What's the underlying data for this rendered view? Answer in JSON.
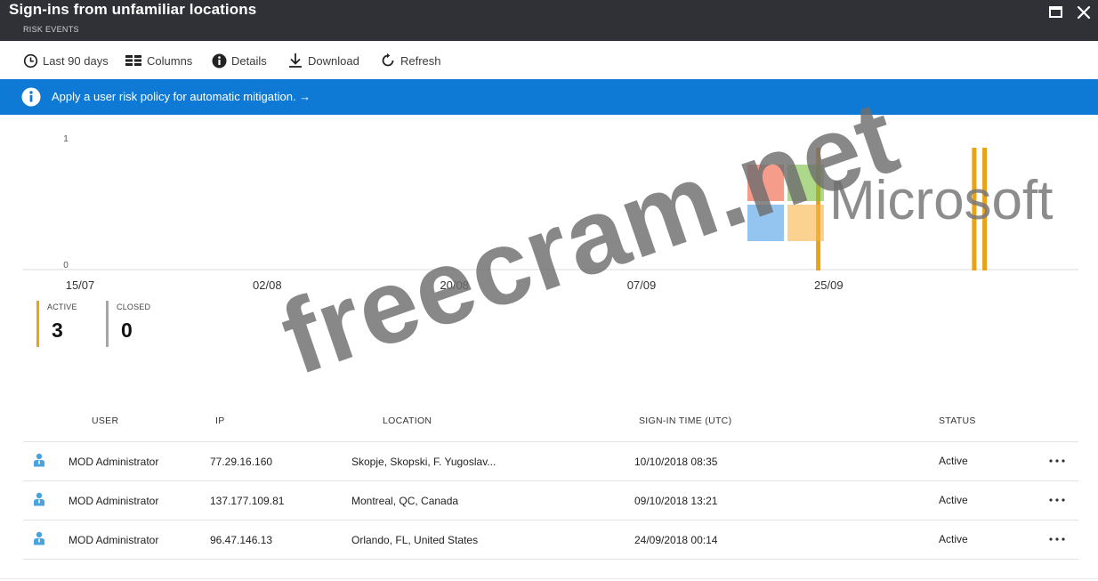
{
  "header": {
    "title": "Sign-ins from unfamiliar locations",
    "subtitle": "RISK EVENTS"
  },
  "toolbar": {
    "items": [
      {
        "label": "Last 90 days",
        "icon": "clock-icon"
      },
      {
        "label": "Columns",
        "icon": "columns-icon"
      },
      {
        "label": "Details",
        "icon": "info-icon"
      },
      {
        "label": "Download",
        "icon": "download-icon"
      },
      {
        "label": "Refresh",
        "icon": "refresh-icon"
      }
    ]
  },
  "banner": {
    "text": "Apply a user risk policy for automatic mitigation. →",
    "icon": "info-circle-icon"
  },
  "chart_data": {
    "type": "bar",
    "x_ticks": [
      "15/07",
      "02/08",
      "20/08",
      "07/09",
      "25/09"
    ],
    "y_ticks": [
      "1",
      "0"
    ],
    "ylim": [
      0,
      1
    ],
    "xlim": [
      "15/07/2018",
      "15/10/2018"
    ],
    "grid": false,
    "bar_color": "#e8a317",
    "points": [
      {
        "date": "24/09/2018",
        "value": 1
      },
      {
        "date": "09/10/2018",
        "value": 1
      },
      {
        "date": "10/10/2018",
        "value": 1
      }
    ]
  },
  "summary": {
    "active": {
      "label": "ACTIVE",
      "count": "3",
      "color": "#e8a317"
    },
    "closed": {
      "label": "CLOSED",
      "count": "0",
      "color": "#a6a6a6"
    }
  },
  "table": {
    "columns": [
      "USER",
      "IP",
      "LOCATION",
      "SIGN-IN TIME (UTC)",
      "STATUS"
    ],
    "rows": [
      {
        "user": "MOD Administrator",
        "ip": "77.29.16.160",
        "location": "Skopje, Skopski, F. Yugoslav...",
        "time": "10/10/2018 08:35",
        "status": "Active"
      },
      {
        "user": "MOD Administrator",
        "ip": "137.177.109.81",
        "location": "Montreal, QC, Canada",
        "time": "09/10/2018 13:21",
        "status": "Active"
      },
      {
        "user": "MOD Administrator",
        "ip": "96.47.146.13",
        "location": "Orlando, FL, United States",
        "time": "24/09/2018 00:14",
        "status": "Active"
      }
    ]
  },
  "watermark": {
    "text": "freecram.net",
    "brand": "Microsoft"
  },
  "colors": {
    "header_bg": "#2f3137",
    "banner_bg": "#0f7ad6",
    "accent_active": "#e8a317"
  }
}
